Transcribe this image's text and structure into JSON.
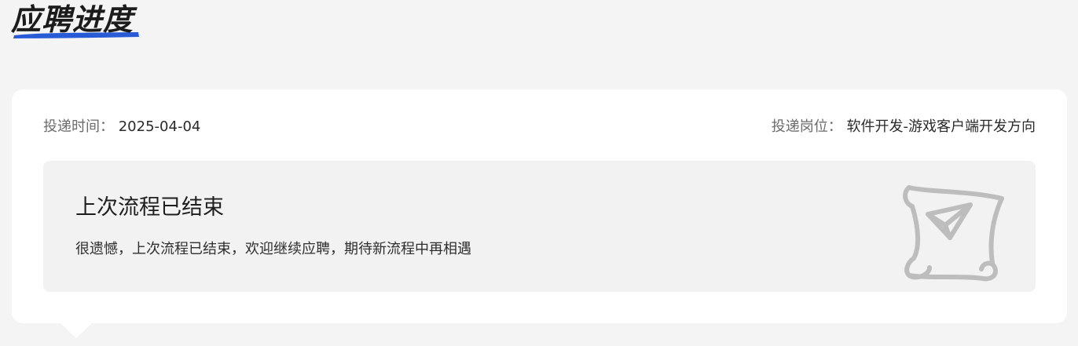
{
  "page": {
    "title": "应聘进度"
  },
  "application": {
    "submit_time_label": "投递时间：",
    "submit_time_value": "2025-04-04",
    "position_label": "投递岗位：",
    "position_value": "软件开发-游戏客户端开发方向"
  },
  "status": {
    "title": "上次流程已结束",
    "description": "很遗憾，上次流程已结束，欢迎继续应聘，期待新流程中再相遇",
    "icon": "scroll-paper-plane-icon"
  },
  "colors": {
    "background": "#f4f4f4",
    "card": "#ffffff",
    "panel": "#f2f2f2",
    "title_underline": "#2a5bd7",
    "icon": "#bdbdbd"
  }
}
